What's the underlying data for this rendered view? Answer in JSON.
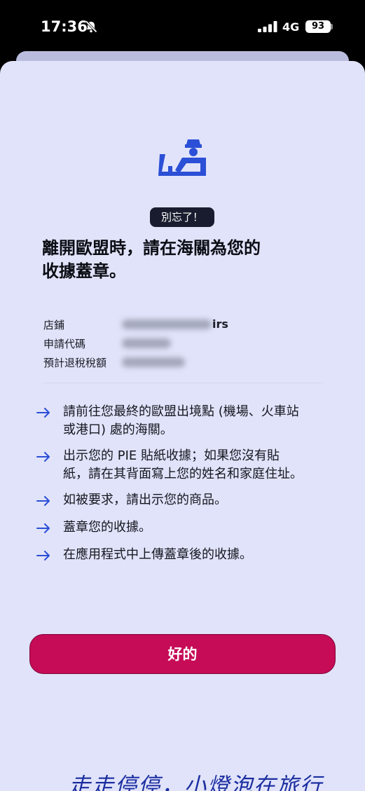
{
  "status_bar": {
    "time": "17:36",
    "network": "4G",
    "battery": "93"
  },
  "badge": "別忘了！",
  "headline": {
    "line1": "離開歐盟時，請在海關為您的",
    "line2": "收據蓋章。"
  },
  "details": {
    "store_label": "店鋪",
    "store_value_visible": "irs",
    "code_label": "申請代碼",
    "refund_label": "預計退稅稅額"
  },
  "steps": [
    {
      "line1": "請前往您最終的歐盟出境點 (機場、火車站",
      "line2": "或港口) 處的海關。"
    },
    {
      "line1": "出示您的 PIE 貼紙收據；如果您沒有貼",
      "line2": "紙，請在其背面寫上您的姓名和家庭住址。"
    },
    {
      "line1": "如被要求，請出示您的商品。"
    },
    {
      "line1": "蓋章您的收據。"
    },
    {
      "line1": "在應用程式中上傳蓋章後的收據。"
    }
  ],
  "ok_button": "好的",
  "watermark": "走走停停，小燈泡在旅行",
  "colors": {
    "sheet": "#e1e3fa",
    "accent_blue": "#2b4fd6",
    "button": "#c60b57",
    "badge": "#181c2e"
  },
  "icons": [
    "bell-slash-icon",
    "signal-icon",
    "battery-icon",
    "customs-officer-icon",
    "arrow-right-icon"
  ]
}
